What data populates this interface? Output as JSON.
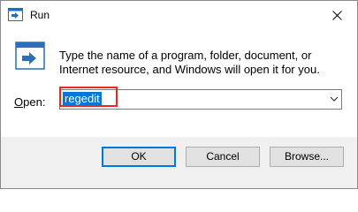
{
  "window": {
    "title": "Run",
    "icon": "run-icon",
    "close_icon": "close-icon"
  },
  "dialog": {
    "description": "Type the name of a program, folder, document, or Internet resource, and Windows will open it for you.",
    "open_label_accel": "O",
    "open_label_rest": "pen:",
    "open_value": "regedit",
    "dropdown_icon": "chevron-down-icon",
    "highlight_color": "#e8291f",
    "selection_color": "#0078d7"
  },
  "buttons": {
    "ok": "OK",
    "cancel": "Cancel",
    "browse": "Browse..."
  }
}
